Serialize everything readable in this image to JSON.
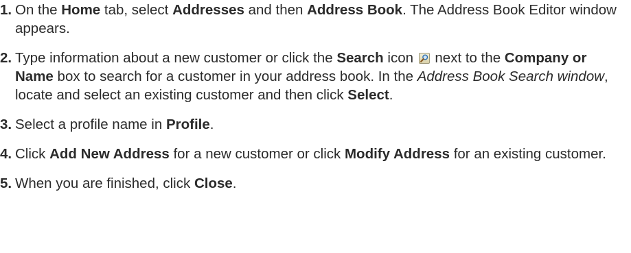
{
  "steps": [
    {
      "number": "1.",
      "parts": [
        {
          "text": "On the ",
          "style": ""
        },
        {
          "text": "Home",
          "style": "b"
        },
        {
          "text": " tab, select ",
          "style": ""
        },
        {
          "text": "Addresses",
          "style": "b"
        },
        {
          "text": " and then ",
          "style": ""
        },
        {
          "text": "Address Book",
          "style": "b"
        },
        {
          "text": ". The Address Book Editor window appears.",
          "style": ""
        }
      ]
    },
    {
      "number": "2.",
      "parts": [
        {
          "text": "Type information about a new customer or click the ",
          "style": ""
        },
        {
          "text": "Search",
          "style": "b"
        },
        {
          "text": " icon ",
          "style": ""
        },
        {
          "icon": "search-icon"
        },
        {
          "text": " next to the ",
          "style": ""
        },
        {
          "text": "Company or Name",
          "style": "b"
        },
        {
          "text": " box to search for a customer in your address book. In the ",
          "style": ""
        },
        {
          "text": "Address Book Search window",
          "style": "i"
        },
        {
          "text": ", locate and select an existing customer and then click ",
          "style": ""
        },
        {
          "text": "Select",
          "style": "b"
        },
        {
          "text": ".",
          "style": ""
        }
      ]
    },
    {
      "number": "3.",
      "parts": [
        {
          "text": "Select a profile name in ",
          "style": ""
        },
        {
          "text": "Profile",
          "style": "b"
        },
        {
          "text": ".",
          "style": ""
        }
      ]
    },
    {
      "number": "4.",
      "parts": [
        {
          "text": "Click ",
          "style": ""
        },
        {
          "text": "Add New Address",
          "style": "b"
        },
        {
          "text": " for a new customer or click ",
          "style": ""
        },
        {
          "text": "Modify Address",
          "style": "b"
        },
        {
          "text": " for an existing customer.",
          "style": ""
        }
      ]
    },
    {
      "number": "5.",
      "parts": [
        {
          "text": "When you are finished, click ",
          "style": ""
        },
        {
          "text": "Close",
          "style": "b"
        },
        {
          "text": ".",
          "style": ""
        }
      ]
    }
  ]
}
